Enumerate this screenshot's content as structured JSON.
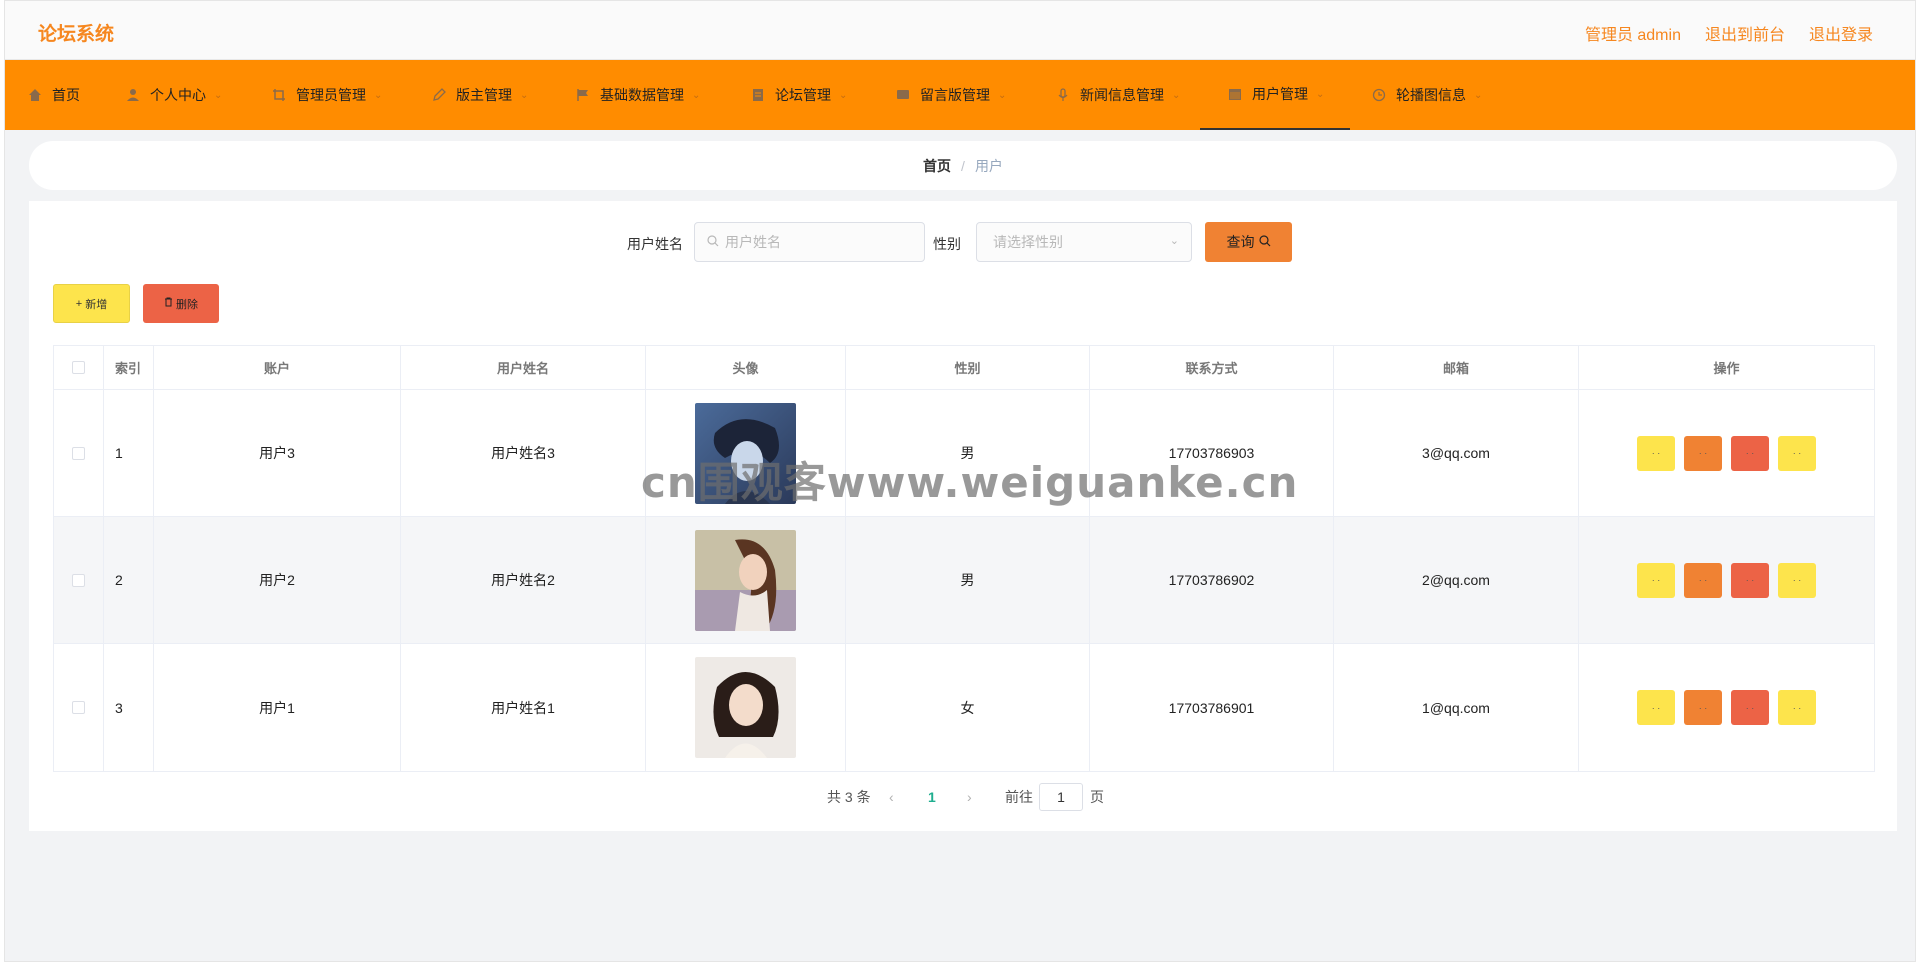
{
  "header": {
    "brand": "论坛系统",
    "links": [
      "管理员 admin",
      "退出到前台",
      "退出登录"
    ]
  },
  "nav": {
    "items": [
      {
        "label": "首页",
        "icon": "home-icon",
        "has_chevron": false
      },
      {
        "label": "个人中心",
        "icon": "user-icon",
        "has_chevron": true
      },
      {
        "label": "管理员管理",
        "icon": "crop-icon",
        "has_chevron": true
      },
      {
        "label": "版主管理",
        "icon": "edit-icon",
        "has_chevron": true
      },
      {
        "label": "基础数据管理",
        "icon": "flag-icon",
        "has_chevron": true
      },
      {
        "label": "论坛管理",
        "icon": "document-icon",
        "has_chevron": true
      },
      {
        "label": "留言版管理",
        "icon": "message-icon",
        "has_chevron": true
      },
      {
        "label": "新闻信息管理",
        "icon": "microphone-icon",
        "has_chevron": true
      },
      {
        "label": "用户管理",
        "icon": "calendar-icon",
        "has_chevron": true,
        "active": true
      },
      {
        "label": "轮播图信息",
        "icon": "clock-icon",
        "has_chevron": true
      }
    ]
  },
  "breadcrumb": {
    "home": "首页",
    "separator": "/",
    "current": "用户"
  },
  "search": {
    "name_label": "用户姓名",
    "name_placeholder": "用户姓名",
    "gender_label": "性别",
    "gender_placeholder": "请选择性别",
    "query_label": "查询"
  },
  "actions": {
    "add_label": "新增",
    "delete_label": "删除"
  },
  "table": {
    "headers": [
      "",
      "索引",
      "账户",
      "用户姓名",
      "头像",
      "性别",
      "联系方式",
      "邮箱",
      "操作"
    ],
    "rows": [
      {
        "index": "1",
        "account": "用户3",
        "name": "用户姓名3",
        "gender": "男",
        "phone": "17703786903",
        "email": "3@qq.com"
      },
      {
        "index": "2",
        "account": "用户2",
        "name": "用户姓名2",
        "gender": "男",
        "phone": "17703786902",
        "email": "2@qq.com"
      },
      {
        "index": "3",
        "account": "用户1",
        "name": "用户姓名1",
        "gender": "女",
        "phone": "17703786901",
        "email": "1@qq.com"
      }
    ],
    "op_button_text": "· ·"
  },
  "pagination": {
    "total_text": "共 3 条",
    "current_page": "1",
    "goto_label": "前往",
    "goto_value": "1",
    "page_unit": "页"
  },
  "watermark": "cn围观客www.weiguanke.cn",
  "colors": {
    "accent": "#ff8c00",
    "brand_text": "#f6871f",
    "yellow_button": "#fde44c",
    "orange_button": "#f08233",
    "red_button": "#ec6346",
    "current_page": "#1fae8f"
  }
}
